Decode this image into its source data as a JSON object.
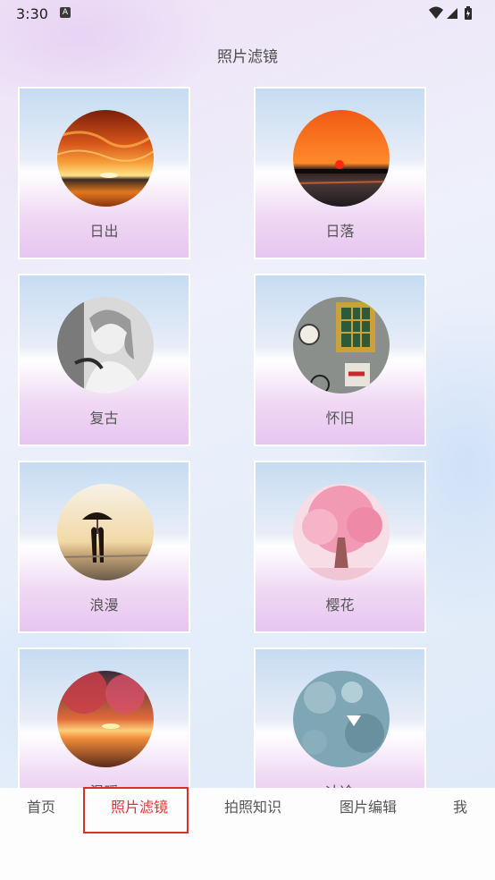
{
  "status_bar": {
    "time": "3:30",
    "notification_icon": "A"
  },
  "page": {
    "title": "照片滤镜"
  },
  "filters": [
    {
      "label": "日出",
      "image": "sunrise-clouds"
    },
    {
      "label": "日落",
      "image": "sunset-sea"
    },
    {
      "label": "复古",
      "image": "vintage-portrait"
    },
    {
      "label": "怀旧",
      "image": "nostalgic-wall"
    },
    {
      "label": "浪漫",
      "image": "romantic-couple-umbrella"
    },
    {
      "label": "樱花",
      "image": "cherry-blossom-tree"
    },
    {
      "label": "温暖",
      "image": "warm-sunset-tree"
    },
    {
      "label": "冰冷",
      "image": "cold-bokeh"
    }
  ],
  "bottom_nav": {
    "items": [
      "首页",
      "照片滤镜",
      "拍照知识",
      "图片编辑",
      "我"
    ],
    "active_index": 1
  },
  "colors": {
    "accent": "#e8312e",
    "highlight_box": "#d8302d"
  }
}
